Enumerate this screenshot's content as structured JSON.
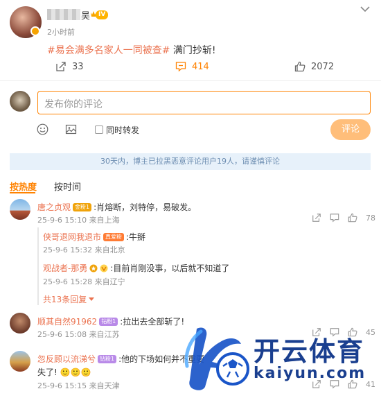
{
  "post": {
    "username_tail": "吴",
    "level": "IV",
    "time": "2小时前",
    "hashtag": "#易会满多名家人一同被查#",
    "text": "满门抄斩!",
    "reposts": "33",
    "comments": "414",
    "likes": "2072"
  },
  "compose": {
    "placeholder": "发布你的评论",
    "repost_label": "同时转发",
    "submit_label": "评论"
  },
  "notice": "30天内，博主已拉黑恶意评论用户19人，请谨慎评论",
  "sort": {
    "hot": "按热度",
    "time": "按时间"
  },
  "comments": [
    {
      "user": "唐之贞观",
      "badge": "金粉1",
      "text": ":肖熔断，刘特停，易破发。",
      "meta": "25-9-6 15:10 来自上海",
      "likes": "78",
      "replies": [
        {
          "user": "侠哥退网我退市",
          "badge": "真爱粉",
          "text": ":牛掰",
          "meta": "25-9-6 15:32 来自北京"
        },
        {
          "user": "观战者-那勇",
          "badge": "",
          "text": ":目前肖刚没事，以后就不知道了",
          "meta": "25-9-6 15:28 来自辽宁"
        }
      ],
      "more_replies": "共13条回复"
    },
    {
      "user": "顺其自然91962",
      "badge": "钻粉1",
      "text": ":拉出去全部斩了!",
      "meta": "25-9-6 15:08 来自江苏",
      "likes": "45"
    },
    {
      "user": "忽反顾以流涕兮",
      "badge": "钻粉1",
      "text": ":他的下场如何并不重要",
      "text2": "失了! 🙂🙂🙂",
      "meta": "25-9-6 15:15 来自天津",
      "likes": "41"
    }
  ],
  "watermark": {
    "brand": "开云体育",
    "url": "kaiyun.com"
  },
  "colors": {
    "accent": "#ff8200",
    "link": "#eb7350",
    "notice_bg": "#e7f1fa"
  }
}
